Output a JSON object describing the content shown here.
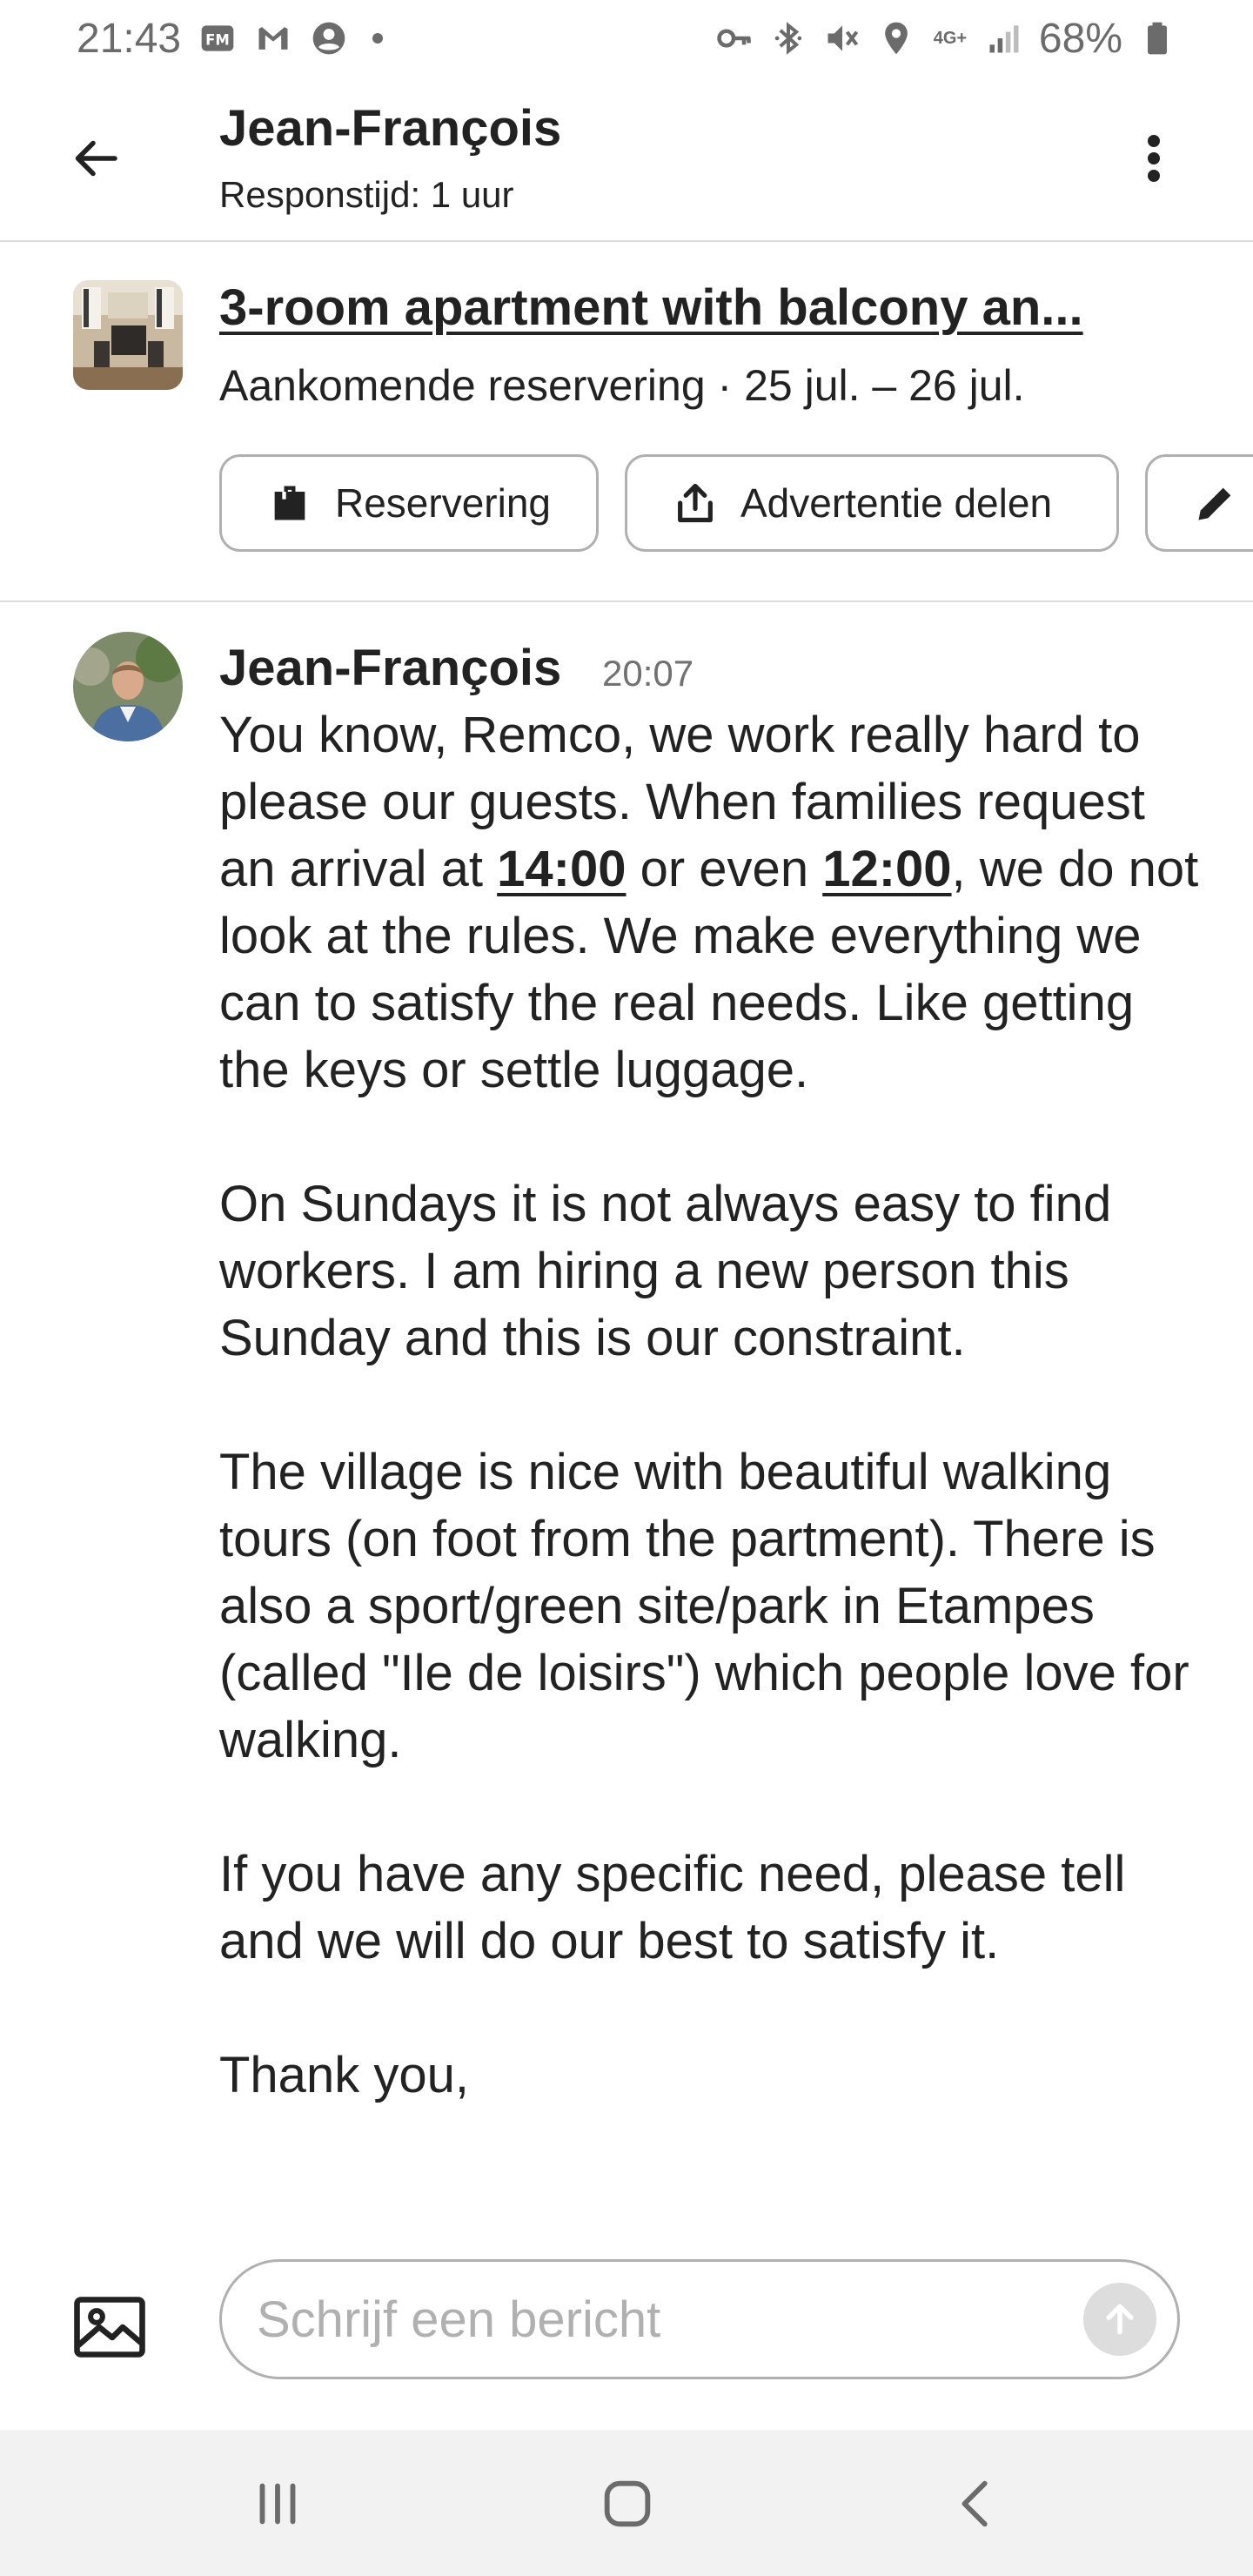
{
  "status_bar": {
    "time": "21:43",
    "battery": "68%",
    "network": "4G+",
    "left_icons": [
      "fm-icon",
      "gmail-icon",
      "account-icon",
      "dot-icon"
    ],
    "right_icons": [
      "key-icon",
      "bluetooth-icon",
      "mute-icon",
      "location-icon",
      "signal-icon",
      "battery-icon"
    ]
  },
  "header": {
    "title": "Jean-François",
    "subtitle": "Responstijd: 1 uur"
  },
  "listing": {
    "title": "3-room apartment with balcony an...",
    "subtitle": "Aankomende reservering · 25 jul. – 26 jul.",
    "chips": [
      {
        "label": "Reservering",
        "icon": "briefcase-icon"
      },
      {
        "label": "Advertentie delen",
        "icon": "share-icon"
      },
      {
        "label": "",
        "icon": "pencil-icon"
      }
    ]
  },
  "message": {
    "sender": "Jean-François",
    "time": "20:07",
    "p1_a": "You know, Remco, we work really hard to please our guests. When families request an arrival at ",
    "p1_link1": "14:00",
    "p1_b": " or even ",
    "p1_link2": "12:00",
    "p1_c": ", we do not look at the rules. We make everything we can to satisfy the real needs. Like getting the keys or settle luggage.",
    "p2": "On Sundays it is not always easy to find workers. I am hiring a new person this Sunday and this is our constraint.",
    "p3": "The village is nice with beautiful walking tours (on foot from the partment). There is also a sport/green site/park in Etampes (called \"Ile de loisirs\") which people love for walking.",
    "p4": "If you have any specific need, please tell and we will do our best to satisfy it.",
    "p5": "Thank you,"
  },
  "composer": {
    "placeholder": "Schrijf een bericht"
  },
  "colors": {
    "text": "#222222",
    "secondary": "#717171",
    "border": "#b0b0b0",
    "divider": "#dddddd",
    "navbar_bg": "#f2f2f2"
  }
}
